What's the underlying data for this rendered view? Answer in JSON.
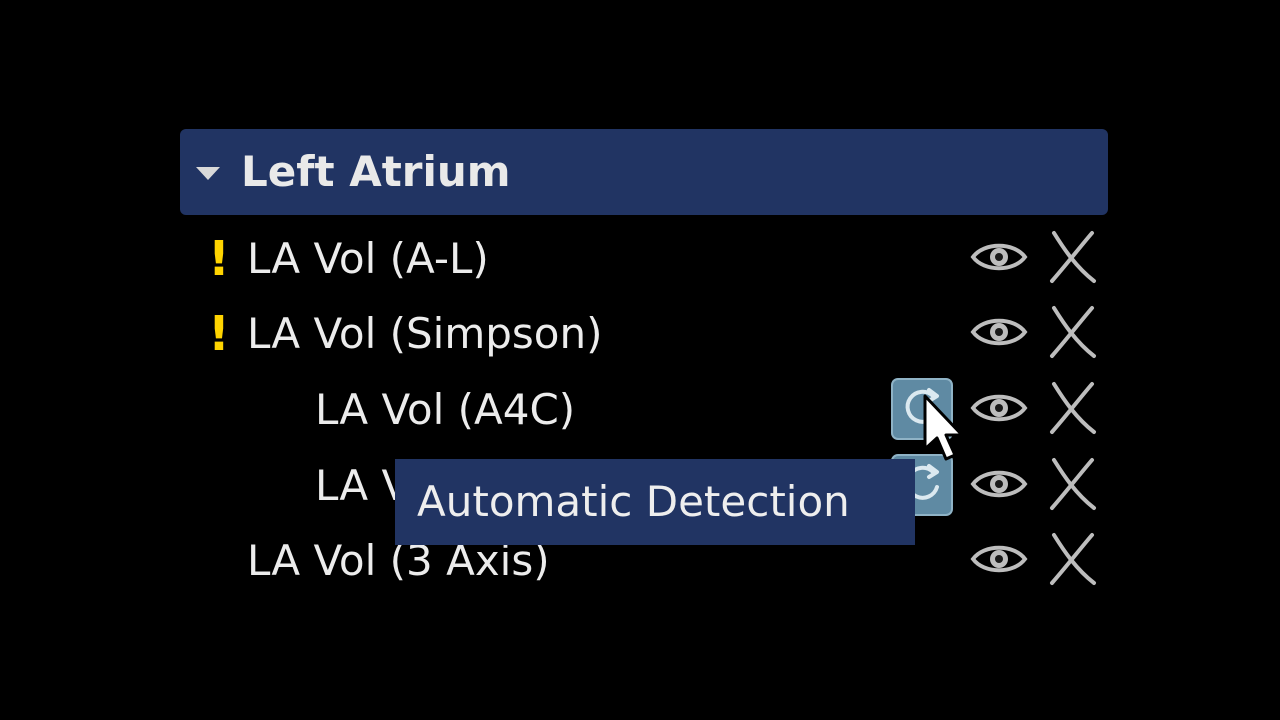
{
  "section": {
    "title": "Left Atrium",
    "expand_icon": "caret-down-icon"
  },
  "rows": [
    {
      "label": "LA Vol (A-L)",
      "warning": "!",
      "indent": 0,
      "has_detection": false,
      "eye_icon": "eye-icon",
      "x_icon": "caliper-x-icon"
    },
    {
      "label": "LA Vol (Simpson)",
      "warning": "!",
      "indent": 0,
      "has_detection": false,
      "eye_icon": "eye-icon",
      "x_icon": "caliper-x-icon"
    },
    {
      "label": "LA Vol (A4C)",
      "warning": "",
      "indent": 1,
      "has_detection": true,
      "eye_icon": "eye-icon",
      "x_icon": "caliper-x-icon"
    },
    {
      "label": "LA V",
      "warning": "",
      "indent": 1,
      "has_detection": true,
      "eye_icon": "eye-icon",
      "x_icon": "caliper-x-icon"
    },
    {
      "label": "LA Vol (3 Axis)",
      "warning": "",
      "indent": 0,
      "has_detection": false,
      "eye_icon": "eye-icon",
      "x_icon": "caliper-x-icon"
    }
  ],
  "tooltip": {
    "text": "Automatic Detection"
  },
  "colors": {
    "background": "#000000",
    "header": "#213463",
    "warning": "#ffd400",
    "detect_button": "#5f8aa3",
    "text": "#ececec"
  }
}
